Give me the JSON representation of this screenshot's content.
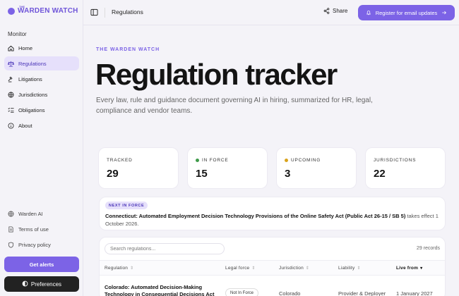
{
  "brand": {
    "small": "THE",
    "name": "WARDEN WATCH"
  },
  "sidebar": {
    "section": "Monitor",
    "items": [
      {
        "label": "Home",
        "icon": "home-icon"
      },
      {
        "label": "Regulations",
        "icon": "scale-icon",
        "active": true
      },
      {
        "label": "Litigations",
        "icon": "gavel-icon"
      },
      {
        "label": "Jurisdictions",
        "icon": "globe-icon"
      },
      {
        "label": "Obligations",
        "icon": "checklist-icon"
      },
      {
        "label": "About",
        "icon": "info-icon"
      }
    ],
    "bottom": [
      {
        "label": "Warden AI",
        "icon": "globe-icon"
      },
      {
        "label": "Terms of use",
        "icon": "document-icon"
      },
      {
        "label": "Privacy policy",
        "icon": "shield-icon"
      }
    ],
    "alerts_button": "Get alerts",
    "preferences_button": "Preferences"
  },
  "topbar": {
    "title": "Regulations",
    "share": "Share",
    "register": "Register for email updates"
  },
  "main": {
    "eyebrow": "THE WARDEN WATCH",
    "title": "Regulation tracker",
    "subtitle": "Every law, rule and guidance document governing AI in hiring, summarized for HR, legal, compliance and vendor teams."
  },
  "stats": [
    {
      "label": "TRACKED",
      "value": "29",
      "dot": ""
    },
    {
      "label": "IN FORCE",
      "value": "15",
      "dot": "#3f9a4a"
    },
    {
      "label": "UPCOMING",
      "value": "3",
      "dot": "#d9a21b"
    },
    {
      "label": "JURISDICTIONS",
      "value": "22",
      "dot": ""
    }
  ],
  "notice": {
    "badge": "NEXT IN FORCE",
    "title": "Connecticut: Automated Employment Decision Technology Provisions of the Online Safety Act (Public Act 26-15 / SB 5)",
    "rest": " takes effect 1 October 2026."
  },
  "table": {
    "search_placeholder": "Search regulations...",
    "records": "29 records",
    "columns": [
      "Regulation",
      "Legal force",
      "Jurisdiction",
      "Liability",
      "Live from"
    ],
    "rows": [
      {
        "regulation": "Colorado: Automated Decision-Making Technology in Consequential Decisions Act",
        "legal_force": "Not In Force",
        "jurisdiction": "Colorado",
        "liability": "Provider & Deployer",
        "live_from": "1 January 2027"
      }
    ]
  },
  "colors": {
    "accent": "#7c63e6",
    "in_force": "#3f9a4a",
    "upcoming": "#d9a21b"
  }
}
